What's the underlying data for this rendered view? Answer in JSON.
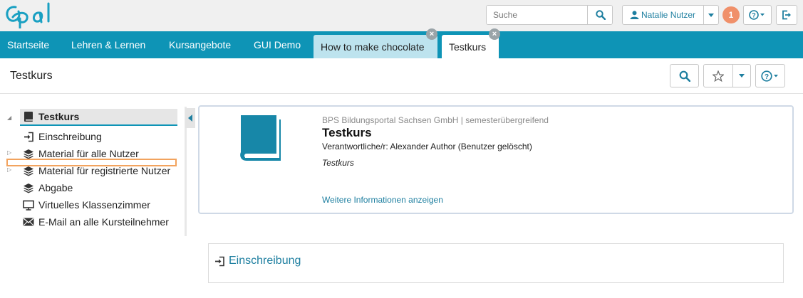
{
  "header": {
    "logo_text": "Opal",
    "search_placeholder": "Suche",
    "user_name": "Natalie Nutzer",
    "notification_count": "1"
  },
  "nav": {
    "items": [
      "Startseite",
      "Lehren & Lernen",
      "Kursangebote",
      "GUI Demo"
    ],
    "tabs": [
      {
        "label": "How to make chocolate",
        "active": false
      },
      {
        "label": "Testkurs",
        "active": true
      }
    ],
    "close_glyph": "×"
  },
  "title_row": {
    "title": "Testkurs"
  },
  "tree": {
    "root": "Testkurs",
    "items": [
      {
        "label": "Einschreibung",
        "icon": "enroll-icon"
      },
      {
        "label": "Material für alle Nutzer",
        "icon": "layers-icon"
      },
      {
        "label": "Material für registrierte Nutzer",
        "icon": "layers-icon"
      },
      {
        "label": "Abgabe",
        "icon": "layers-icon"
      },
      {
        "label": "Virtuelles Klassenzimmer",
        "icon": "monitor-icon"
      },
      {
        "label": "E-Mail an alle Kursteilnehmer",
        "icon": "envelope-icon"
      }
    ]
  },
  "course_info": {
    "org_line": "BPS Bildungsportal Sachsen GmbH | semesterübergreifend",
    "title": "Testkurs",
    "responsible": "Verantwortliche/r: Alexander Author (Benutzer gelöscht)",
    "subtitle": "Testkurs",
    "more_info_link": "Weitere Informationen anzeigen"
  },
  "enroll_panel": {
    "link_label": "Einschreibung"
  },
  "colors": {
    "brand": "#0e94b6",
    "link": "#1e7fa0",
    "badge": "#f0906a",
    "highlight": "#f2a35e"
  }
}
